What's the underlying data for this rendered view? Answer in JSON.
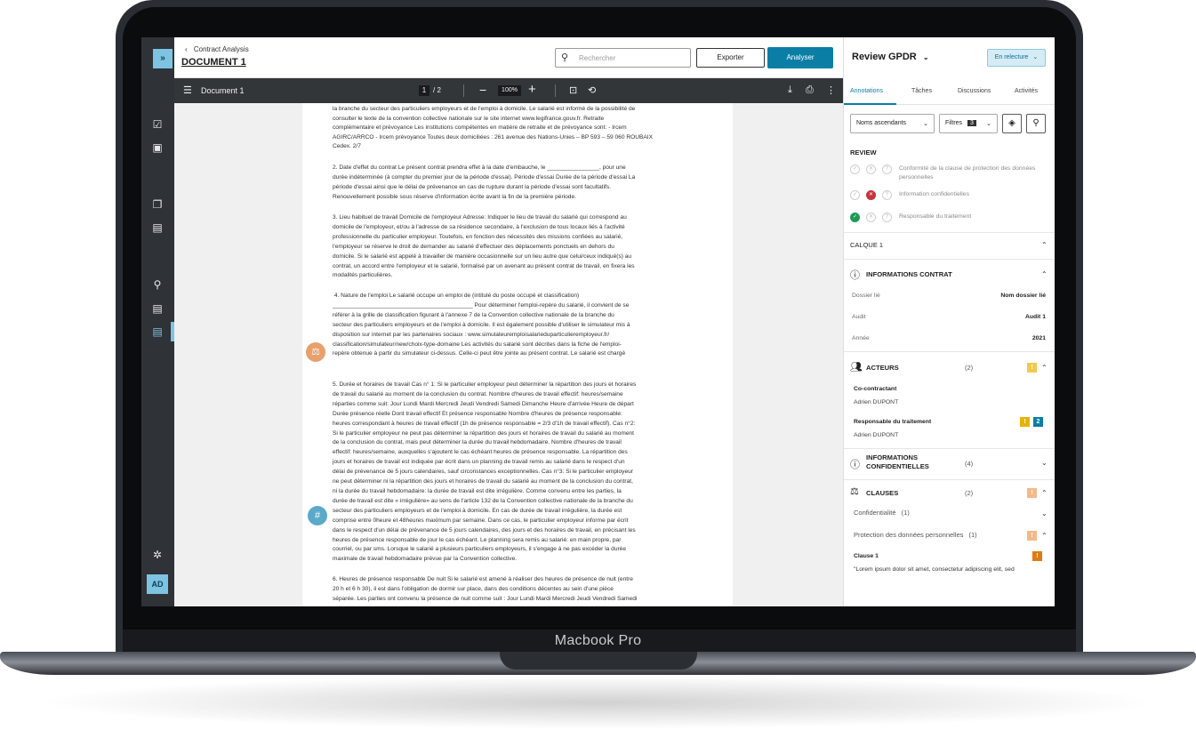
{
  "device": {
    "label": "Macbook Pro"
  },
  "header": {
    "breadcrumb": "Contract Analysis",
    "back_icon": "chevron-left-icon",
    "doc_title": "DOCUMENT 1",
    "search_placeholder": "Rechercher",
    "export_label": "Exporter",
    "analyse_label": "Analyser"
  },
  "rail": {
    "expand_label": "»",
    "avatar": "AD"
  },
  "pdfbar": {
    "doc_name": "Document 1",
    "page_current": "1",
    "page_total": "/ 2",
    "zoom": "100%"
  },
  "document": {
    "paragraphs": [
      "la branche du secteur des particuliers employeurs et de l'emploi à domicile. Le salarié est informé de la possibilité de\nconsulter le texte de la convention collective nationale sur le site internet www.legifrance.gouv.fr. Retraite\ncomplémentaire et prévoyance Les institutions compétentes en matière de retraite et de prévoyance sont: - Ircem\nAGIRC/ARRCO - Ircem prévoyance Toutes deux domiciliées : 261 avenue des Nations-Unies – BP 593 – 59 060 ROUBAIX\nCedex. 2/7",
      "2. Date d'effet du contrat Le présent contrat prendra effet à la date d'embauche, le ________________, pour une\ndurée indéterminée (à compter du premier jour de la période d'essai). Période d'essai Durée de la période d'essai La\npériode d'essai ainsi que le délai de prévenance en cas de rupture durant la période d'essai sont facultatifs.\nRenouvellement possible sous réserve d'information écrite avant la fin de la première période.",
      "3. Lieu habituel de travail Domicile de l'employeur Adresse: Indiquer le lieu de travail du salarié qui correspond au\ndomicile de l'employeur, et/ou à l'adresse de sa résidence secondaire, à l'exclusion de tous locaux liés à l'activité\nprofessionnelle du particulier employeur. Toutefois, en fonction des nécessités des missions confiées au salarié,\nl'employeur se réserve le droit de demander au salarié d'effectuer des déplacements ponctuels en dehors du\ndomicile. Si le salarié est appelé à travailler de manière occasionnelle sur un lieu autre que celui/ceux indiqué(s) au\ncontrat, un accord entre l'employeur et le salarié, formalisé par un avenant au présent contrat de travail, en fixera les\nmodalités particulières.",
      " 4. Nature de l'emploi Le salarié occupe un emploi de (intitulé du poste occupé et classification)\n___________________________________________ Pour déterminer l'emploi-repère du salarié, il convient de se\nréférer à la grille de classification figurant à l'annexe 7 de la Convention collective nationale de la branche du\nsecteur des particuliers employeurs et de l'emploi à domicile. Il est également possible d'utiliser le simulateur mis à\ndisposition sur internet par les partenaires sociaux : www.simulateuremploisalarieduparticulieremployeur.fr/\nclassification/simulateur/new/choix-type-domaine Les activités du salarié sont décrites dans la fiche de l'emploi-\nrepère obtenue à partir du simulateur ci-dessus. Celle-ci peut être jointe au présent contrat. Le salarié est chargé",
      "5. Durée et horaires de travail Cas n° 1: Si le particulier employeur peut déterminer la répartition des jours et horaires\nde travail du salarié au moment de la conclusion du contrat. Nombre d'heures de travail effectif: heures/semaine\nréparties comme suit: Jour Lundi Mardi Mercredi Jeudi Vendredi Samedi Dimanche Heure d'arrivée Heure de départ\nDurée présence réelle Dont travail effectif Et présence responsable Nombre d'heures de présence responsable:\nheures correspondant à heures de travail effectif (1h de présence responsable = 2/3 d'1h de travail effectif). Cas n°2:\nSi le particulier employeur ne peut pas déterminer la répartition des jours et horaires de travail du salarié au moment\nde la conclusion du contrat, mais peut déterminer la durée du travail hebdomadaire. Nombre d'heures de travail\neffectif: heures/semaine, auxquelles s'ajoutent le cas échéant heures de présence responsable. La répartition des\njours et horaires de travail est indiquée par écrit dans un planning de travail remis au salarié dans le respect d'un\ndélai de prévenance de 5 jours calendaires, sauf circonstances exceptionnelles. Cas n°3: Si le particulier employeur\nne peut déterminer ni la répartition des jours et horaires de travail du salarié au moment de la conclusion du contrat,\nni la durée du travail hebdomadaire: la durée de travail est dite irrégulière. Comme convenu entre les parties, la\ndurée de travail est dite « irrégulière» au sens de l'article 132 de la Convention collective nationale de la branche du\nsecteur des particuliers employeurs et de l'emploi à domicile. En cas de durée de travail irrégulière, la durée est\ncomprise entre 0heure et 48heures maximum par semaine. Dans ce cas, le particulier employeur informe par écrit\ndans le respect d'un délai de prévenance de 5 jours calendaires, des jours et des horaires de travail, en précisant les\nheures de présence responsable de jour le cas échéant. Le planning sera remis au salarié: en main propre, par\ncourriel, ou par sms. Lorsque le salarié a plusieurs particuliers employeurs, il s'engage à ne pas excéder la durée\nmaximale de travail hebdomadaire prévue par la Convention collective.",
      "6. Heures de présence responsable De nuit Si le salarié est amené à réaliser des heures de présence de nuit (entre\n20 h et 6 h 30), il est dans l'obligation de dormir sur place, dans des conditions décentes au sein d'une pièce\nséparée. Les parties ont convenu la présence de nuit comme suit : Jour Lundi Mardi Mercredi Jeudi Vendredi Samedi"
    ],
    "marker_1_color": "#e8a06c",
    "marker_2_color": "#5aa9c9",
    "marker_2_glyph": "#"
  },
  "panel": {
    "title": "Review GPDR",
    "status": "En relecture",
    "tabs": [
      "Annotations",
      "Tâches",
      "Discussions",
      "Activités"
    ],
    "sort_label": "Noms ascendants",
    "filter_label": "Filtres",
    "filter_count": "3",
    "review_header": "REVIEW",
    "review_items": [
      {
        "label": "Conformité de la clause de protection des données personnelles",
        "state": "none"
      },
      {
        "label": "Information confidentielles",
        "state": "rejected"
      },
      {
        "label": "Responsable du traitement",
        "state": "approved"
      }
    ],
    "layer": "CALQUE 1",
    "info_contract": {
      "title": "INFORMATIONS CONTRAT",
      "rows": [
        {
          "k": "Dossier lié",
          "v": "Nom dossier lié"
        },
        {
          "k": "Audit",
          "v": "Audit 1"
        },
        {
          "k": "Année",
          "v": "2021"
        }
      ]
    },
    "actors": {
      "title": "ACTEURS",
      "count": "(2)",
      "flag": "!",
      "items": [
        {
          "role": "Co-contractant",
          "name": "Adrien DUPONT"
        },
        {
          "role": "Responsable du traitement",
          "name": "Adrien DUPONT",
          "flag": "!",
          "badge": "2"
        }
      ]
    },
    "confidential": {
      "title": "INFORMATIONS CONFIDENTIELLES",
      "count": "(4)"
    },
    "clauses": {
      "title": "CLAUSES",
      "count": "(2)",
      "flag": "!",
      "sub": [
        {
          "label": "Confidentialité",
          "count": "(1)"
        },
        {
          "label": "Protection des données personnelles",
          "count": "(1)",
          "flag": "!"
        }
      ],
      "clause_title": "Clause 1",
      "clause_flag": "!",
      "clause_text": "\"Lorem ipsum dolor sit amet, consectetur adipiscing elit, sed"
    }
  }
}
